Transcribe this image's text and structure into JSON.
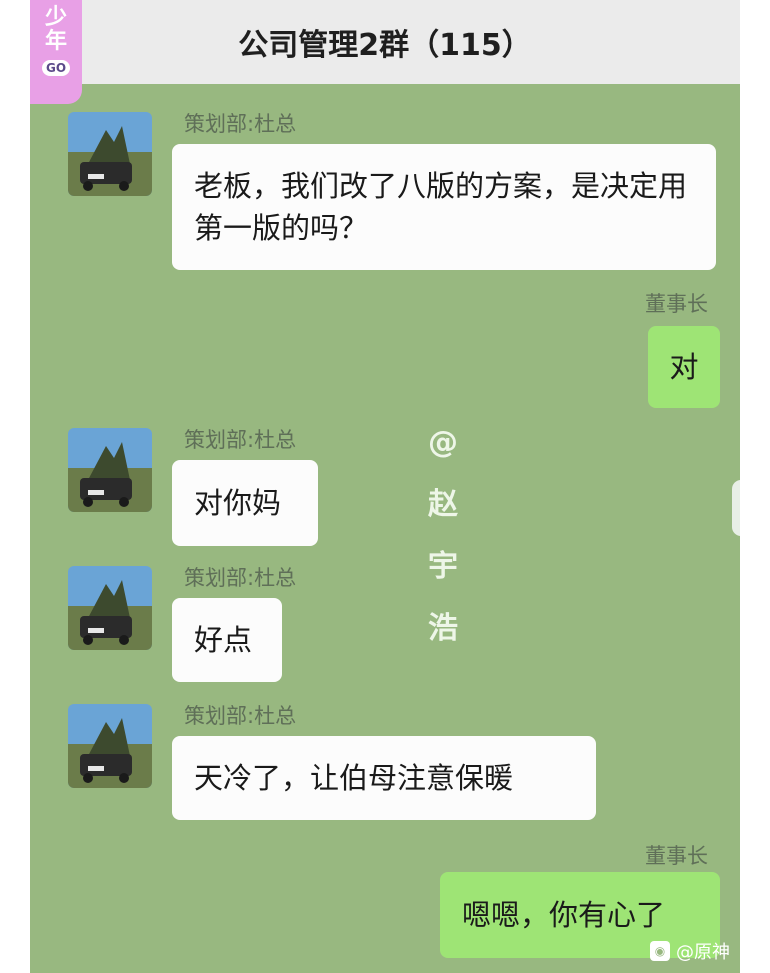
{
  "header": {
    "title": "公司管理2群（115）"
  },
  "sticker": {
    "line1": "少",
    "line2": "年",
    "badge": "GO"
  },
  "messages": [
    {
      "from": "策划部:杜总",
      "text": "老板，我们改了八版的方案，是决定用第一版的吗？"
    },
    {
      "from": "董事长",
      "text": "对"
    },
    {
      "from": "策划部:杜总",
      "text": "对你妈"
    },
    {
      "from": "策划部:杜总",
      "text": "好点"
    },
    {
      "from": "策划部:杜总",
      "text": "天冷了，让伯母注意保暖"
    },
    {
      "from": "董事长",
      "text": "嗯嗯，你有心了"
    }
  ],
  "watermark": {
    "at": "@",
    "c1": "赵",
    "c2": "宇",
    "c3": "浩"
  },
  "corner_watermark": {
    "text": "@原神"
  },
  "colors": {
    "chat_bg": "#98b880",
    "my_bubble": "#9ee475",
    "their_bubble": "#fcfcfc",
    "header_bg": "#ebebeb"
  }
}
